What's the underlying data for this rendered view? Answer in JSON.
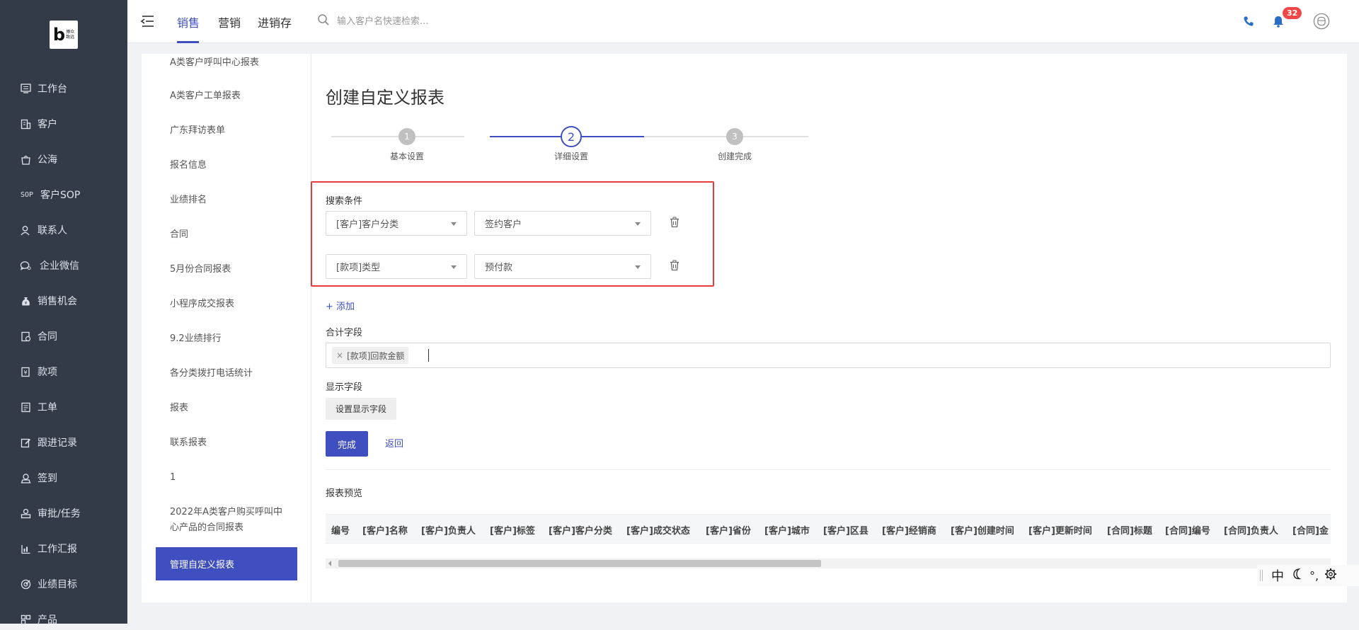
{
  "app": {
    "logo_text": "博众 致远"
  },
  "sidebar": {
    "items": [
      {
        "label": "工作台",
        "icon": "monitor-icon"
      },
      {
        "label": "客户",
        "icon": "building-icon"
      },
      {
        "label": "公海",
        "icon": "bag-icon"
      },
      {
        "label": "客户SOP",
        "icon": "sop-icon"
      },
      {
        "label": "联系人",
        "icon": "person-icon"
      },
      {
        "label": "企业微信",
        "icon": "wechat-icon"
      },
      {
        "label": "销售机会",
        "icon": "money-bag-icon"
      },
      {
        "label": "合同",
        "icon": "contract-icon"
      },
      {
        "label": "款项",
        "icon": "payment-icon"
      },
      {
        "label": "工单",
        "icon": "ticket-icon"
      },
      {
        "label": "跟进记录",
        "icon": "edit-icon"
      },
      {
        "label": "签到",
        "icon": "location-icon"
      },
      {
        "label": "审批/任务",
        "icon": "approval-icon"
      },
      {
        "label": "工作汇报",
        "icon": "report-icon"
      },
      {
        "label": "业绩目标",
        "icon": "target-icon"
      },
      {
        "label": "产品",
        "icon": "product-icon"
      }
    ]
  },
  "header": {
    "tabs": [
      {
        "label": "销售",
        "active": true
      },
      {
        "label": "营销",
        "active": false
      },
      {
        "label": "进销存",
        "active": false
      }
    ],
    "search_placeholder": "输入客户名快速检索...",
    "notification_count": "32"
  },
  "report_list": {
    "items": [
      "A类客户呼叫中心报表",
      "A类客户工单报表",
      "广东拜访表单",
      "报名信息",
      "业绩排名",
      "合同",
      "5月份合同报表",
      "小程序成交报表",
      "9.2业绩排行",
      "各分类拨打电话统计",
      "报表",
      "联系报表",
      "1",
      "2022年A类客户购买呼叫中心产品的合同报表"
    ],
    "active_item": "管理自定义报表"
  },
  "form": {
    "title": "创建自定义报表",
    "steps": [
      {
        "number": "1",
        "label": "基本设置"
      },
      {
        "number": "2",
        "label": "详细设置"
      },
      {
        "number": "3",
        "label": "创建完成"
      }
    ],
    "current_step": 2,
    "search_conditions_label": "搜索条件",
    "conditions": [
      {
        "field": "[客户]客户分类",
        "value": "签约客户"
      },
      {
        "field": "[款项]类型",
        "value": "预付款"
      }
    ],
    "add_label": "+ 添加",
    "sum_fields_label": "合计字段",
    "sum_fields": [
      "[款项]回款金额"
    ],
    "display_fields_label": "显示字段",
    "set_display_button": "设置显示字段",
    "finish_button": "完成",
    "back_link": "返回",
    "preview_label": "报表预览",
    "preview_columns": [
      "编号",
      "[客户]名称",
      "[客户]负责人",
      "[客户]标签",
      "[客户]客户分类",
      "[客户]成交状态",
      "[客户]省份",
      "[客户]城市",
      "[客户]区县",
      "[客户]经销商",
      "[客户]创建时间",
      "[客户]更新时间",
      "[合同]标题",
      "[合同]编号",
      "[合同]负责人",
      "[合同]金"
    ]
  },
  "ime_toolbar": {
    "lang": "中",
    "punct": "°,"
  },
  "colors": {
    "primary": "#3f4fbf",
    "sidebar_bg": "#343b48",
    "highlight_border": "#e83b3b",
    "badge": "#f04848"
  }
}
